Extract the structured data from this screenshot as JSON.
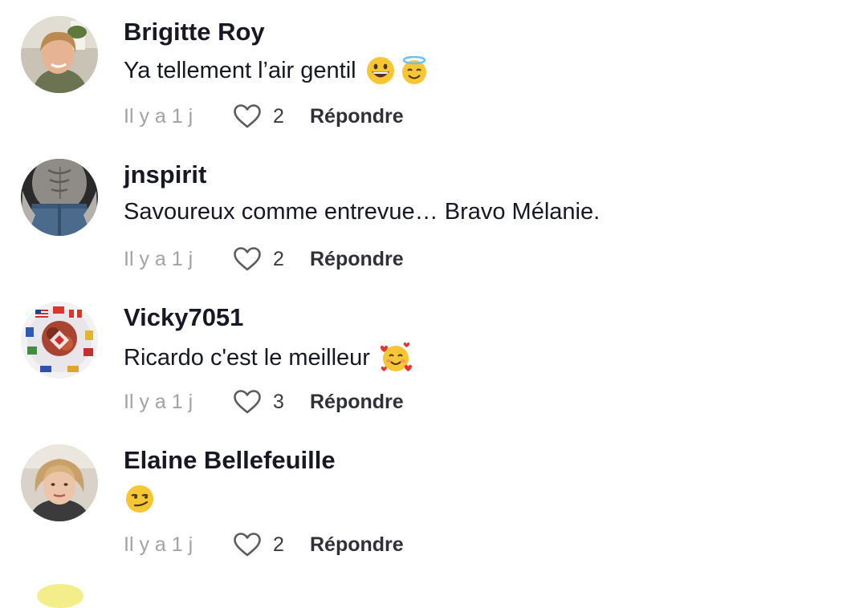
{
  "comments": [
    {
      "username": "Brigitte Roy",
      "text": "Ya tellement l’air gentil",
      "emojis": [
        "grinning-face",
        "smiling-face-with-halo"
      ],
      "time": "Il y a 1 j",
      "likes": "2",
      "reply_label": "Répondre",
      "avatar": "woman-smiling-photo"
    },
    {
      "username": "jnspirit",
      "text": "Savoureux comme entrevue… Bravo Mélanie.",
      "emojis": [],
      "time": "Il y a 1 j",
      "likes": "2",
      "reply_label": "Répondre",
      "avatar": "shirtless-man-photo"
    },
    {
      "username": "Vicky7051",
      "text": "Ricardo c'est le meilleur",
      "emojis": [
        "smiling-face-with-hearts"
      ],
      "time": "Il y a 1 j",
      "likes": "3",
      "reply_label": "Répondre",
      "avatar": "flags-collage-photo"
    },
    {
      "username": "Elaine Bellefeuille",
      "text": "",
      "emojis": [
        "smirking-face"
      ],
      "time": "Il y a 1 j",
      "likes": "2",
      "reply_label": "Répondre",
      "avatar": "woman-portrait-photo"
    }
  ],
  "colors": {
    "text": "#161823",
    "muted": "#a1a2a7",
    "heart_outline": "#5a5b63",
    "emoji_yellow": "#f7c634"
  }
}
